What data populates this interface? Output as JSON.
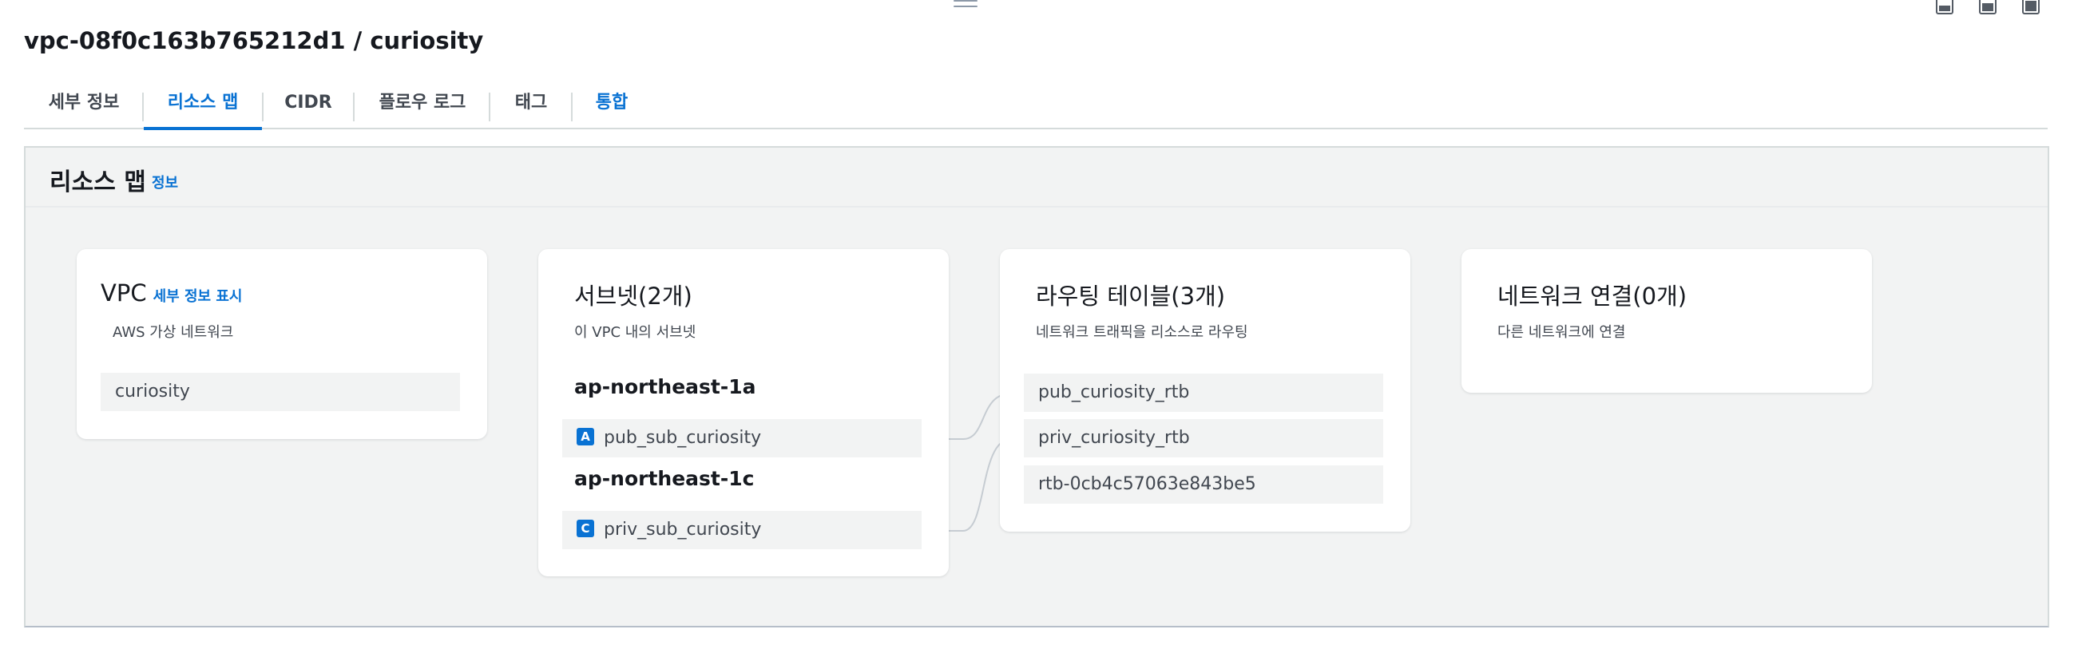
{
  "header": {
    "title": "vpc-08f0c163b765212d1 / curiosity"
  },
  "tabs": [
    {
      "label": "세부 정보"
    },
    {
      "label": "리소스 맵"
    },
    {
      "label": "CIDR"
    },
    {
      "label": "플로우 로그"
    },
    {
      "label": "태그"
    },
    {
      "label": "통합"
    }
  ],
  "resource_map": {
    "title": "리소스 맵",
    "info_link": "정보",
    "vpc": {
      "title": "VPC",
      "details_link": "세부 정보 표시",
      "subtitle": "AWS 가상 네트워크",
      "item": "curiosity"
    },
    "subnets": {
      "title": "서브넷(2개)",
      "subtitle": "이 VPC 내의 서브넷",
      "groups": [
        {
          "az": "ap-northeast-1a",
          "badge": "A",
          "subnet": "pub_sub_curiosity"
        },
        {
          "az": "ap-northeast-1c",
          "badge": "C",
          "subnet": "priv_sub_curiosity"
        }
      ]
    },
    "route_tables": {
      "title": "라우팅 테이블(3개)",
      "subtitle": "네트워크 트래픽을 리소스로 라우팅",
      "items": [
        "pub_curiosity_rtb",
        "priv_curiosity_rtb",
        "rtb-0cb4c57063e843be5"
      ]
    },
    "network_connections": {
      "title": "네트워크 연결(0개)",
      "subtitle": "다른 네트워크에 연결"
    }
  },
  "colors": {
    "accent": "#0972d3",
    "text": "#16191f",
    "item_bg": "#f2f3f3",
    "connector": "#c6ccd2"
  }
}
